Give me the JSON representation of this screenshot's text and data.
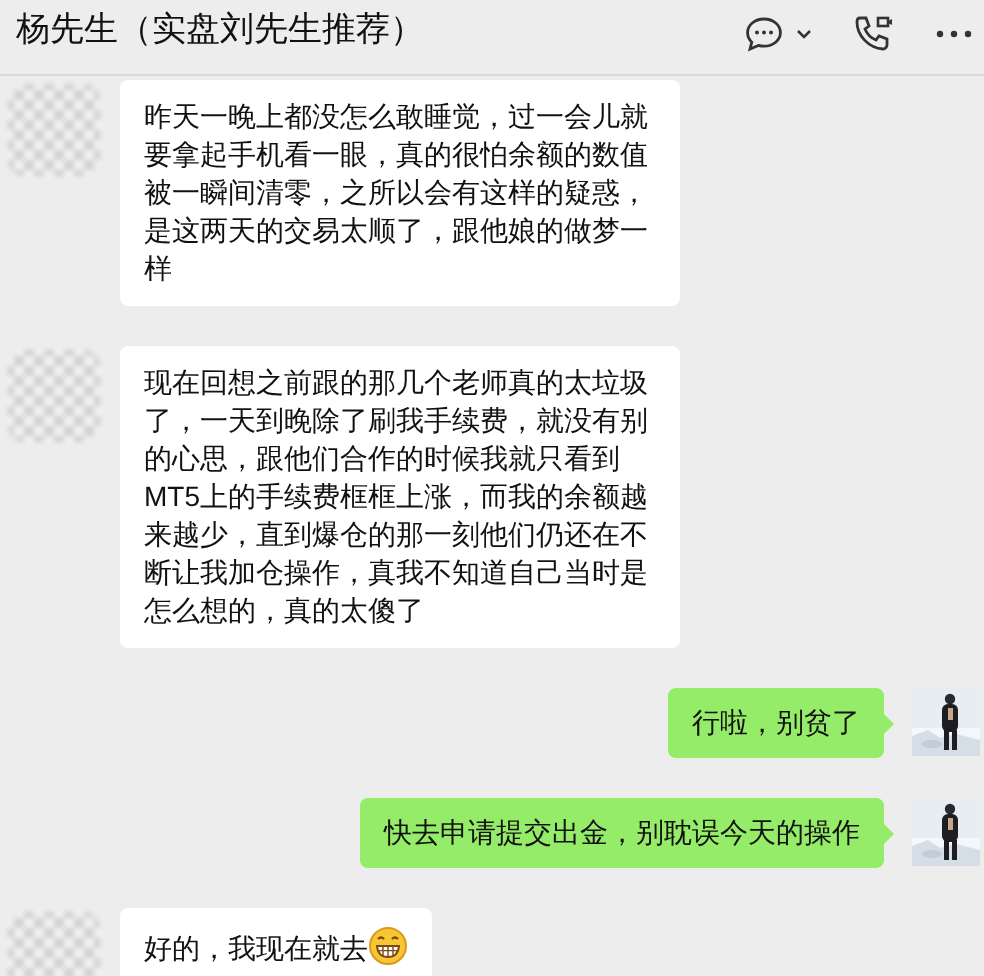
{
  "header": {
    "title": "杨先生（实盘刘先生推荐）"
  },
  "messages": [
    {
      "kind": "received",
      "text": "昨天一晚上都没怎么敢睡觉，过一会儿就要拿起手机看一眼，真的很怕余额的数值被一瞬间清零，之所以会有这样的疑惑，是这两天的交易太顺了，跟他娘的做梦一样"
    },
    {
      "kind": "received",
      "text": "现在回想之前跟的那几个老师真的太垃圾了，一天到晚除了刷我手续费，就没有别的心思，跟他们合作的时候我就只看到MT5上的手续费框框上涨，而我的余额越来越少，直到爆仓的那一刻他们仍还在不断让我加仓操作，真我不知道自己当时是怎么想的，真的太傻了"
    },
    {
      "kind": "sent",
      "text": "行啦，别贫了"
    },
    {
      "kind": "sent",
      "text": "快去申请提交出金，别耽误今天的操作"
    },
    {
      "kind": "received",
      "text": "好的，我现在就去",
      "emoji": true
    }
  ]
}
